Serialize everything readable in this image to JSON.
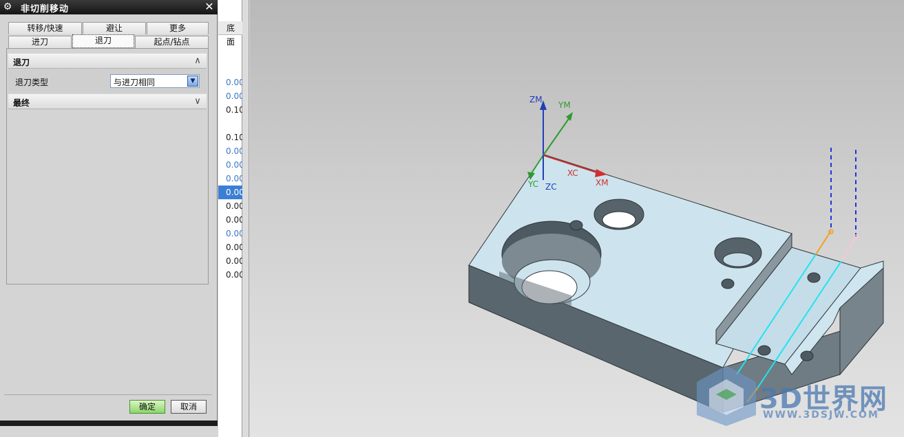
{
  "dialog": {
    "title": "非切削移动",
    "tabs_row1": [
      "转移/快速",
      "避让",
      "更多"
    ],
    "tabs_row2": [
      "进刀",
      "退刀",
      "起点/钻点"
    ],
    "active_tab": "退刀",
    "groups": {
      "retract": {
        "title": "退刀",
        "field_label": "退刀类型",
        "field_value": "与进刀相同",
        "state": "expanded"
      },
      "final": {
        "title": "最终",
        "state": "collapsed"
      }
    },
    "ok_label": "确定",
    "cancel_label": "取消"
  },
  "background_list": {
    "header": "底面",
    "rows": [
      "0.00",
      "0.00",
      "0.10",
      "",
      "0.10",
      "0.00",
      "0.00",
      "0.00",
      "0.00",
      "0.00",
      "0.00",
      "0.00",
      "0.00",
      "0.00",
      "0.00"
    ],
    "selected_index": 8
  },
  "viewport": {
    "axes": {
      "zm": "ZM",
      "ym": "YM",
      "xc": "XC",
      "xm": "XM",
      "yc": "YC",
      "zc": "ZC"
    },
    "watermark": {
      "brand": "3D世界网",
      "url": "WWW.3DSJW.COM"
    }
  },
  "colors": {
    "part_top": "#cde4ee",
    "part_side": "#5e6b72",
    "toolpath_cyan": "#22e3f0",
    "toolpath_orange": "#f0a020",
    "axis_x": "#d03030",
    "axis_y": "#2f9a2f",
    "axis_z": "#1f3fb8"
  }
}
